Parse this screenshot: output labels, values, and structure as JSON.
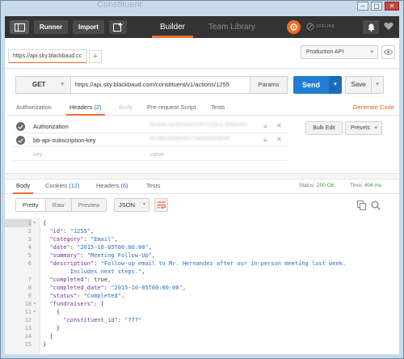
{
  "window": {
    "ghost_title": "Constituent",
    "minimize": "–",
    "maximize": "▢",
    "close": "✕"
  },
  "topbar": {
    "runner_label": "Runner",
    "import_label": "Import",
    "tabs": [
      {
        "label": "Builder",
        "active": true
      },
      {
        "label": "Team Library",
        "active": false
      }
    ],
    "offline_label": "OFFLINE"
  },
  "request_tab": {
    "label": "https://api.sky.blackbaud.cc",
    "add": "+"
  },
  "environment": {
    "selected": "Production API"
  },
  "request": {
    "method": "GET",
    "url": "https://api.sky.blackbaud.com/constituent/v1/actions/1255",
    "params_label": "Params",
    "send_label": "Send",
    "save_label": "Save"
  },
  "request_tabs": {
    "authorization": "Authorization",
    "headers": "Headers",
    "headers_count": "(2)",
    "body": "Body",
    "prerequest": "Pre-request Script",
    "tests": "Tests",
    "generate_code": "Generate Code"
  },
  "headers": [
    {
      "key": "Authorization",
      "value": "Bearer eyJ0eXAiOiJKV1QiLCJhbGciOi"
    },
    {
      "key": "bb-api-subscription-key",
      "value": "bf1d9ea93de4427faa4bd9f8640"
    }
  ],
  "headers_placeholder": {
    "key": "key",
    "value": "value"
  },
  "bulk_edit_label": "Bulk Edit",
  "presets_label": "Presets",
  "response_tabs": {
    "body": "Body",
    "cookies": "Cookies",
    "cookies_count": "(12)",
    "headers": "Headers",
    "headers_count": "(6)",
    "tests": "Tests"
  },
  "response_status": {
    "status_label": "Status:",
    "status_value": "200 OK",
    "time_label": "Time:",
    "time_value": "404 ms"
  },
  "view_modes": [
    "Pretty",
    "Raw",
    "Preview"
  ],
  "format": "JSON",
  "code_lines": [
    {
      "n": "1",
      "fold": "▾",
      "text": "{"
    },
    {
      "n": "2",
      "fold": "",
      "key": "\"id\"",
      "val": "\"1255\"",
      "tail": ","
    },
    {
      "n": "3",
      "fold": "",
      "key": "\"category\"",
      "val": "\"Email\"",
      "tail": ","
    },
    {
      "n": "4",
      "fold": "",
      "key": "\"date\"",
      "val": "\"2015-10-05T00:00:00\"",
      "tail": ","
    },
    {
      "n": "5",
      "fold": "",
      "key": "\"summary\"",
      "val": "\"Meeting Follow-Up\"",
      "tail": ","
    },
    {
      "n": "6",
      "fold": "",
      "key": "\"description\"",
      "val": "\"Follow-up email to Mr. Hernandez after our in-person meeting last week.",
      "tail": ""
    },
    {
      "n": "",
      "fold": "",
      "cont": "        Includes next steps.\"",
      "tail": ","
    },
    {
      "n": "7",
      "fold": "",
      "key": "\"completed\"",
      "plain": "true",
      "tail": ","
    },
    {
      "n": "8",
      "fold": "",
      "key": "\"completed_date\"",
      "val": "\"2015-10-05T00:00:00\"",
      "tail": ","
    },
    {
      "n": "9",
      "fold": "",
      "key": "\"status\"",
      "val": "\"Completed\"",
      "tail": ","
    },
    {
      "n": "10",
      "fold": "▾",
      "key": "\"fundraisers\"",
      "plain": "[",
      "tail": ""
    },
    {
      "n": "11",
      "fold": "▾",
      "indent": "    ",
      "text": "{"
    },
    {
      "n": "12",
      "fold": "",
      "indent": "      ",
      "key": "\"constituent_id\"",
      "val": "\"777\"",
      "tail": ""
    },
    {
      "n": "13",
      "fold": "",
      "indent": "    ",
      "text": "}"
    },
    {
      "n": "14",
      "fold": "",
      "indent": "  ",
      "text": "]"
    },
    {
      "n": "15",
      "fold": "",
      "text": "}"
    }
  ]
}
